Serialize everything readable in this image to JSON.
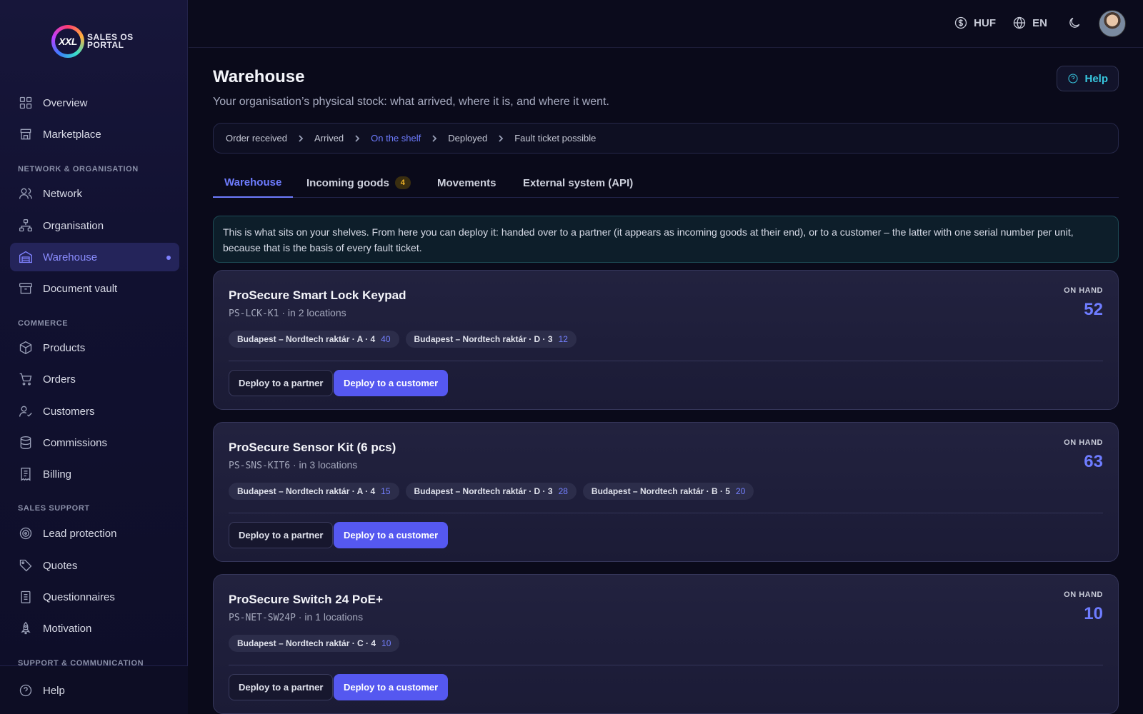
{
  "brand": {
    "logo_mark": "XXL",
    "logo_line1": "SALES OS",
    "logo_line2": "PORTAL"
  },
  "sidebar": {
    "items_top": [
      {
        "label": "Overview",
        "icon": "grid-icon"
      },
      {
        "label": "Marketplace",
        "icon": "store-icon"
      }
    ],
    "section_network": "NETWORK & ORGANISATION",
    "items_network": [
      {
        "label": "Network",
        "icon": "users-icon"
      },
      {
        "label": "Organisation",
        "icon": "org-chart-icon"
      },
      {
        "label": "Warehouse",
        "icon": "warehouse-icon",
        "active": true
      },
      {
        "label": "Document vault",
        "icon": "archive-icon"
      }
    ],
    "section_commerce": "COMMERCE",
    "items_commerce": [
      {
        "label": "Products",
        "icon": "box-icon"
      },
      {
        "label": "Orders",
        "icon": "cart-icon"
      },
      {
        "label": "Customers",
        "icon": "user-check-icon"
      },
      {
        "label": "Commissions",
        "icon": "database-icon"
      },
      {
        "label": "Billing",
        "icon": "receipt-icon"
      }
    ],
    "section_sales": "SALES SUPPORT",
    "items_sales": [
      {
        "label": "Lead protection",
        "icon": "target-icon"
      },
      {
        "label": "Quotes",
        "icon": "tag-icon"
      },
      {
        "label": "Questionnaires",
        "icon": "clipboard-icon"
      },
      {
        "label": "Motivation",
        "icon": "rocket-icon"
      }
    ],
    "section_support": "SUPPORT & COMMUNICATION",
    "bottom_item": {
      "label": "Help",
      "icon": "help-circle-icon"
    }
  },
  "topbar": {
    "currency": "HUF",
    "language": "EN"
  },
  "page": {
    "title": "Warehouse",
    "subtitle": "Your organisation’s physical stock: what arrived, where it is, and where it went.",
    "help_label": "Help"
  },
  "breadcrumb": [
    "Order received",
    "Arrived",
    "On the shelf",
    "Deployed",
    "Fault ticket possible"
  ],
  "tabs": [
    {
      "label": "Warehouse"
    },
    {
      "label": "Incoming goods",
      "badge": "4"
    },
    {
      "label": "Movements"
    },
    {
      "label": "External system (API)"
    }
  ],
  "info": "This is what sits on your shelves. From here you can deploy it: handed over to a partner (it appears as incoming goods at their end), or to a customer – the latter with one serial number per unit, because that is the basis of every fault ticket.",
  "cards_common": {
    "onhand_label": "ON HAND",
    "deploy_partner": "Deploy to a partner",
    "deploy_customer": "Deploy to a customer",
    "separator": " · "
  },
  "products": [
    {
      "name": "ProSecure Smart Lock Keypad",
      "sku": "PS-LCK-K1",
      "locations_text": "in 2 locations",
      "on_hand": "52",
      "locations": [
        {
          "label": "Budapest – Nordtech raktár · A · 4",
          "qty": "40"
        },
        {
          "label": "Budapest – Nordtech raktár · D · 3",
          "qty": "12"
        }
      ]
    },
    {
      "name": "ProSecure Sensor Kit (6 pcs)",
      "sku": "PS-SNS-KIT6",
      "locations_text": "in 3 locations",
      "on_hand": "63",
      "locations": [
        {
          "label": "Budapest – Nordtech raktár · A · 4",
          "qty": "15"
        },
        {
          "label": "Budapest – Nordtech raktár · D · 3",
          "qty": "28"
        },
        {
          "label": "Budapest – Nordtech raktár · B · 5",
          "qty": "20"
        }
      ]
    },
    {
      "name": "ProSecure Switch 24 PoE+",
      "sku": "PS-NET-SW24P",
      "locations_text": "in 1 locations",
      "on_hand": "10",
      "locations": [
        {
          "label": "Budapest – Nordtech raktár · C · 4",
          "qty": "10"
        }
      ]
    }
  ]
}
